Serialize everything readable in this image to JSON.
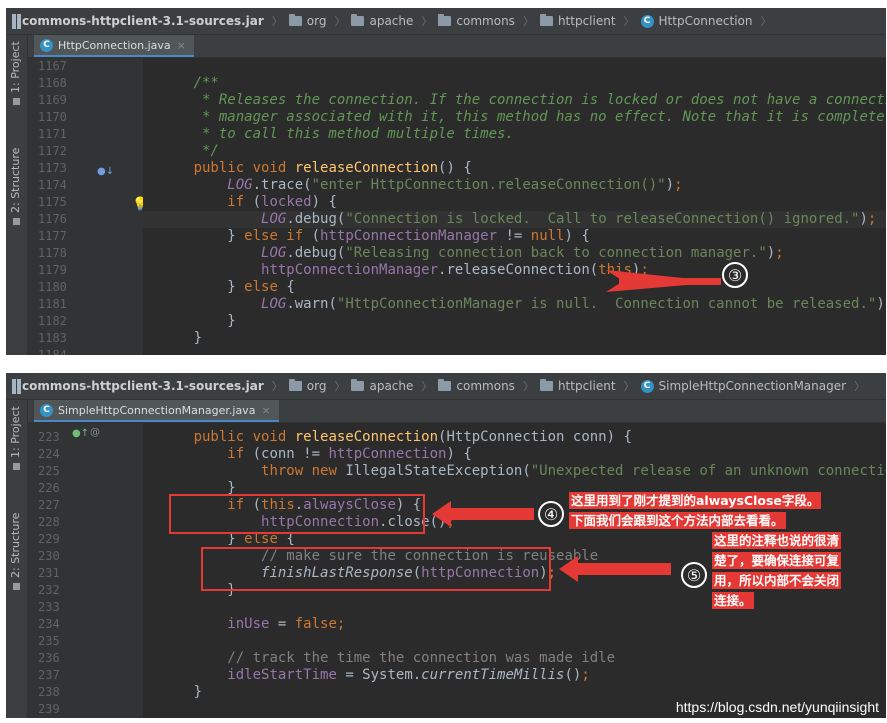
{
  "panel1": {
    "breadcrumb": [
      "commons-httpclient-3.1-sources.jar",
      "org",
      "apache",
      "commons",
      "httpclient",
      "HttpConnection"
    ],
    "sidebar": {
      "project": "1: Project",
      "structure": "2: Structure"
    },
    "tab": "HttpConnection.java",
    "line_numbers": [
      "1167",
      "1168",
      "1169",
      "1170",
      "1171",
      "1172",
      "1173",
      "1174",
      "1175",
      "1176",
      "1177",
      "1178",
      "1179",
      "1180",
      "1181",
      "1182",
      "1183",
      "1184"
    ],
    "marker": "③"
  },
  "panel2": {
    "breadcrumb": [
      "commons-httpclient-3.1-sources.jar",
      "org",
      "apache",
      "commons",
      "httpclient",
      "SimpleHttpConnectionManager"
    ],
    "sidebar": {
      "project": "1: Project",
      "structure": "2: Structure"
    },
    "tab": "SimpleHttpConnectionManager.java",
    "line_numbers": [
      "223",
      "224",
      "225",
      "226",
      "227",
      "228",
      "229",
      "230",
      "231",
      "232",
      "233",
      "234",
      "235",
      "236",
      "237",
      "238",
      "239"
    ],
    "marker4": "④",
    "note4": [
      "这里用到了刚才提到的alwaysClose字段。",
      "下面我们会跟到这个方法内部去看看。"
    ],
    "marker5": "⑤",
    "note5": [
      "这里的注释也说的很清",
      "楚了，要确保连接可复",
      "用，所以内部不会关闭",
      "连接。"
    ]
  },
  "watermark": "https://blog.csdn.net/yunqiinsight",
  "colors": {
    "accent": "#e53935",
    "editor_bg": "#2b2b2b"
  }
}
